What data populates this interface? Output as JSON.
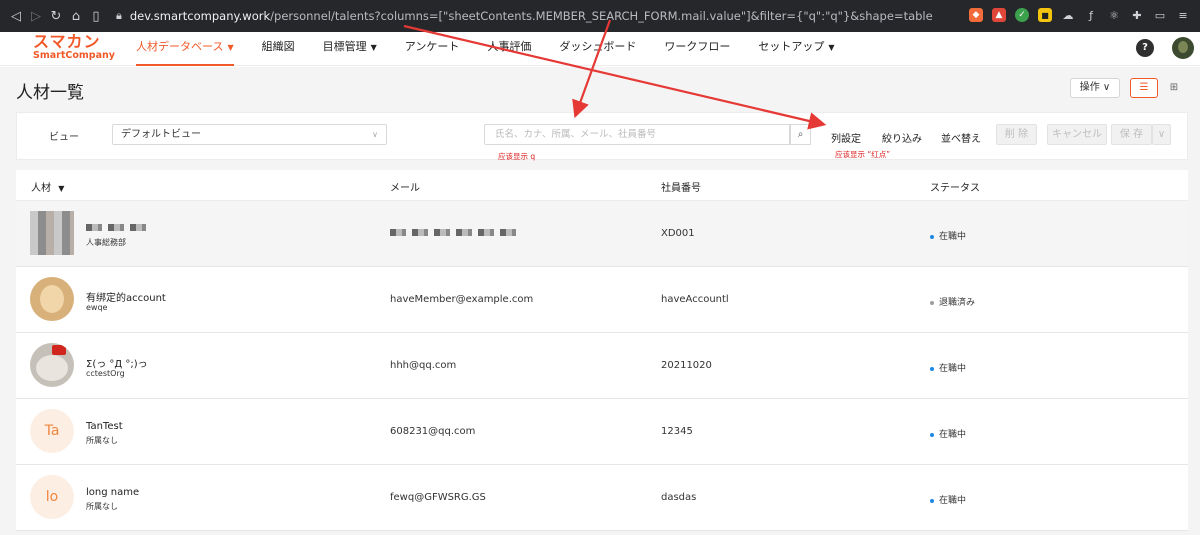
{
  "browser": {
    "url_host": "dev.smartcompany.work",
    "url_path": "/personnel/talents?columns=[\"sheetContents.MEMBER_SEARCH_FORM.mail.value\"]&filter={\"q\":\"q\"}&shape=table"
  },
  "app": {
    "logo_jp": "スマカン",
    "logo_en": "SmartCompany",
    "menu": [
      {
        "label": "人材データベース",
        "caret": "▼",
        "active": true
      },
      {
        "label": "組織図"
      },
      {
        "label": "目標管理",
        "caret": "▼"
      },
      {
        "label": "アンケート"
      },
      {
        "label": "人事評価"
      },
      {
        "label": "ダッシュボード"
      },
      {
        "label": "ワークフロー"
      },
      {
        "label": "セットアップ",
        "caret": "▼"
      }
    ],
    "help_label": "?"
  },
  "page": {
    "title": "人材一覧",
    "op_button": "操作 ∨",
    "view_list_icon": "☰",
    "view_grid_icon": "⊞"
  },
  "toolbar": {
    "view_label": "ビュー",
    "view_select": "デフォルトビュー",
    "search_placeholder": "氏名、カナ、所属、メール、社員番号",
    "search_value": "",
    "columns_link": "列設定",
    "filter_link": "絞り込み",
    "sort_link": "並べ替え",
    "delete_button": "削 除",
    "cancel_button": "キャンセル",
    "save_button": "保 存",
    "save_more": "∨"
  },
  "annotations": {
    "search_note": "应该显示 q",
    "columns_note": "应该显示 “红点”",
    "color": "#e53935"
  },
  "table": {
    "headers": {
      "talent": "人材",
      "talent_caret": "▼",
      "email": "メール",
      "employee_no": "社員番号",
      "status": "ステータス"
    },
    "rows": [
      {
        "avatar": "pixelated",
        "name": "",
        "org": "人事総務部",
        "email": "",
        "employee_no": "XD001",
        "status": "在職中",
        "status_color": "#1e88e5",
        "highlight": true
      },
      {
        "avatar": "dog",
        "name": "有绑定的account",
        "org": "ewqe",
        "email": "haveMember@example.com",
        "employee_no": "haveAccountl",
        "status": "退職済み",
        "status_color": "#9e9e9e"
      },
      {
        "avatar": "cat",
        "name": "Σ(っ °Д °;)っ",
        "org": "cctestOrg",
        "email": "hhh@qq.com",
        "employee_no": "20211020",
        "status": "在職中",
        "status_color": "#1e88e5"
      },
      {
        "avatar": "initial",
        "initial": "Ta",
        "name": "TanTest",
        "org": "所属なし",
        "email": "608231@qq.com",
        "employee_no": "12345",
        "status": "在職中",
        "status_color": "#1e88e5"
      },
      {
        "avatar": "initial",
        "initial": "lo",
        "name": "long name",
        "org": "所属なし",
        "email": "fewq@GFWSRG.GS",
        "employee_no": "dasdas",
        "status": "在職中",
        "status_color": "#1e88e5"
      }
    ]
  }
}
